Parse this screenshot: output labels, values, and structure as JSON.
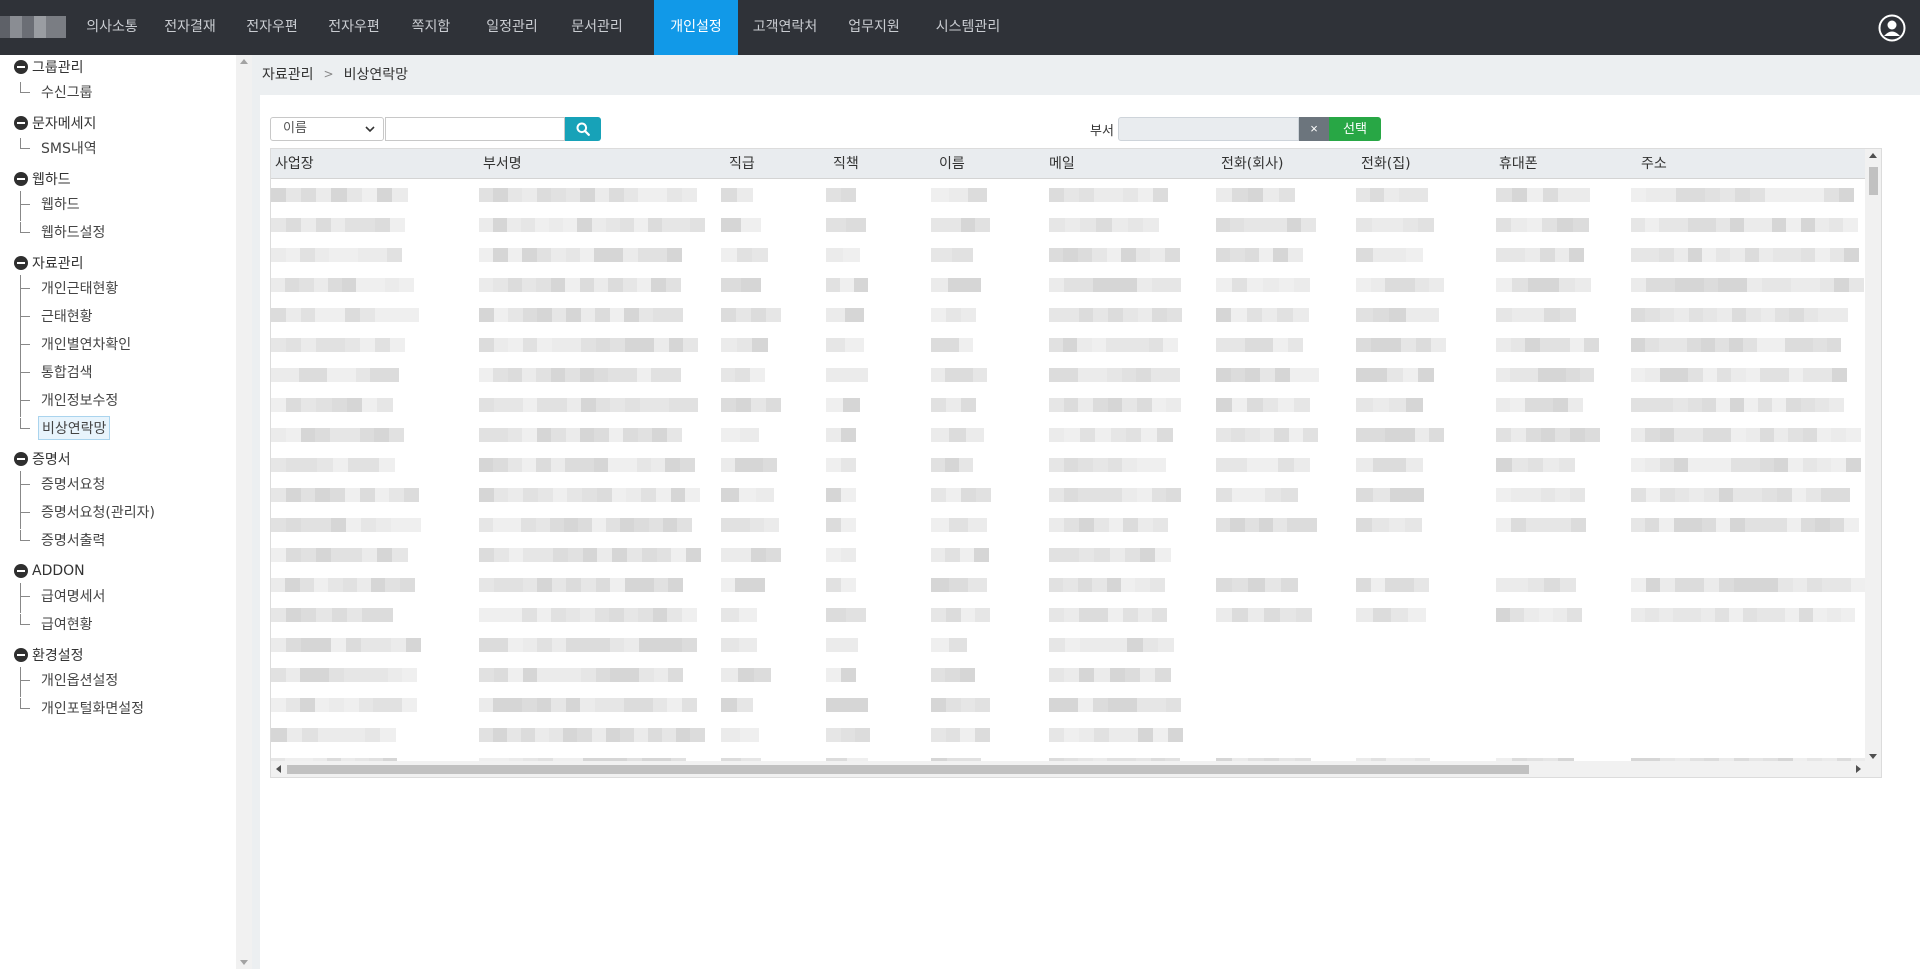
{
  "nav": {
    "items": [
      {
        "label": "의사소통",
        "active": false
      },
      {
        "label": "전자결재",
        "active": false
      },
      {
        "label": "전자우편",
        "active": false
      },
      {
        "label": "전자우편",
        "active": false
      },
      {
        "label": "쪽지함",
        "active": false
      },
      {
        "label": "일정관리",
        "active": false
      },
      {
        "label": "문서관리",
        "active": false
      },
      {
        "label": "개인설정",
        "active": true
      },
      {
        "label": "고객연락처",
        "active": false
      },
      {
        "label": "업무지원",
        "active": false
      },
      {
        "label": "시스템관리",
        "active": false
      }
    ],
    "user_icon": "user-circle-icon",
    "bg_color": "#2f3238",
    "active_color": "#1199e8"
  },
  "sidebar": {
    "groups": [
      {
        "label": "그룹관리",
        "items": [
          "수신그룹"
        ]
      },
      {
        "label": "문자메세지",
        "items": [
          "SMS내역"
        ]
      },
      {
        "label": "웹하드",
        "items": [
          "웹하드",
          "웹하드설정"
        ]
      },
      {
        "label": "자료관리",
        "items": [
          "개인근태현황",
          "근태현황",
          "개인별연차확인",
          "통합검색",
          "개인정보수정",
          "비상연락망"
        ]
      },
      {
        "label": "증명서",
        "items": [
          "증명서요청",
          "증명서요청(관리자)",
          "증명서출력"
        ]
      },
      {
        "label": "ADDON",
        "items": [
          "급여명세서",
          "급여현황"
        ]
      },
      {
        "label": "환경설정",
        "items": [
          "개인옵션설정",
          "개인포털화면설정"
        ]
      }
    ],
    "selected_item": "비상연락망"
  },
  "breadcrumb": {
    "parent": "자료관리",
    "separator": ">",
    "current": "비상연락망"
  },
  "search": {
    "field_select": "이름",
    "query": "",
    "search_icon": "search-icon"
  },
  "department": {
    "label": "부서",
    "value": "",
    "clear_label": "×",
    "select_label": "선택",
    "clear_color": "#6c757d",
    "select_color": "#28a745"
  },
  "table": {
    "columns": [
      "사업장",
      "부서명",
      "직급",
      "직책",
      "이름",
      "메일",
      "전화(회사)",
      "전화(집)",
      "휴대폰",
      "주소"
    ],
    "rows_note_visible_but_pixelated": "",
    "visible_row_count": 20
  }
}
